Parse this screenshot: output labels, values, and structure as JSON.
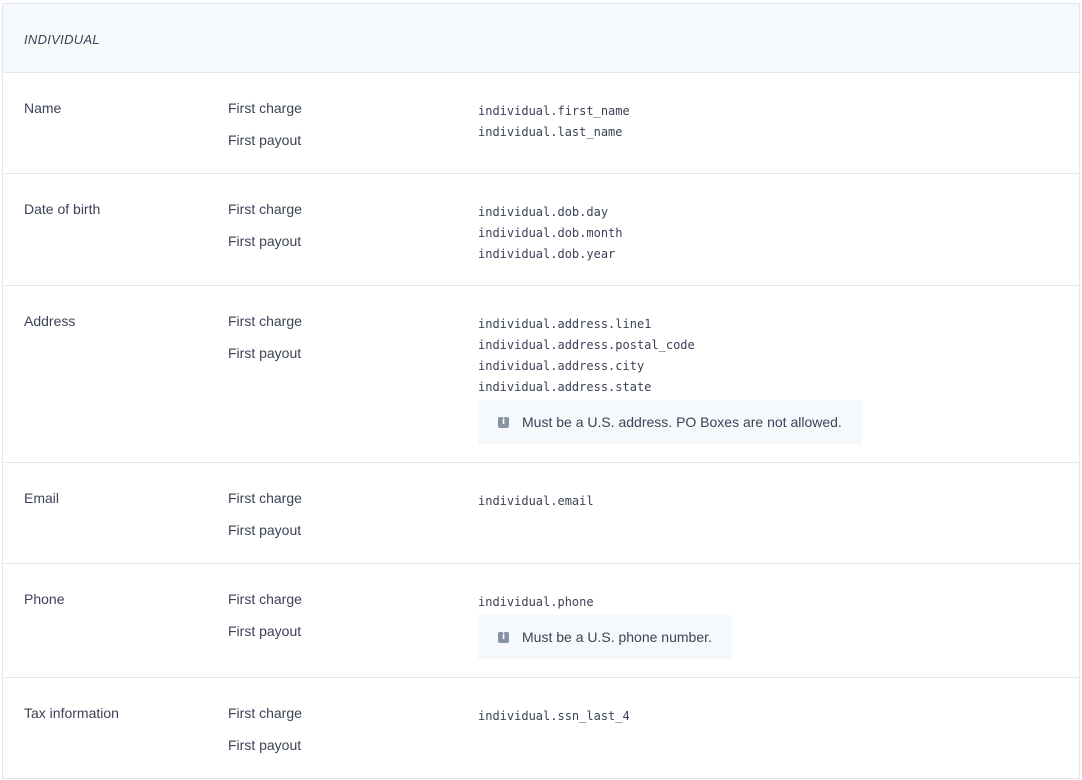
{
  "section": {
    "title": "INDIVIDUAL"
  },
  "rows": [
    {
      "label": "Name",
      "requirements": [
        "First charge",
        "First payout"
      ],
      "fields": [
        "individual.first_name",
        "individual.last_name"
      ]
    },
    {
      "label": "Date of birth",
      "requirements": [
        "First charge",
        "First payout"
      ],
      "fields": [
        "individual.dob.day",
        "individual.dob.month",
        "individual.dob.year"
      ]
    },
    {
      "label": "Address",
      "requirements": [
        "First charge",
        "First payout"
      ],
      "fields": [
        "individual.address.line1",
        "individual.address.postal_code",
        "individual.address.city",
        "individual.address.state"
      ],
      "note": "Must be a U.S. address. PO Boxes are not allowed."
    },
    {
      "label": "Email",
      "requirements": [
        "First charge",
        "First payout"
      ],
      "fields": [
        "individual.email"
      ]
    },
    {
      "label": "Phone",
      "requirements": [
        "First charge",
        "First payout"
      ],
      "fields": [
        "individual.phone"
      ],
      "note": "Must be a U.S. phone number."
    },
    {
      "label": "Tax information",
      "requirements": [
        "First charge",
        "First payout"
      ],
      "fields": [
        "individual.ssn_last_4"
      ]
    }
  ],
  "icons": {
    "info": "info-icon"
  },
  "colors": {
    "header_bg": "#f6f9fc",
    "border": "#e3e8ee",
    "text": "#3c4257",
    "icon": "#8792a2"
  }
}
